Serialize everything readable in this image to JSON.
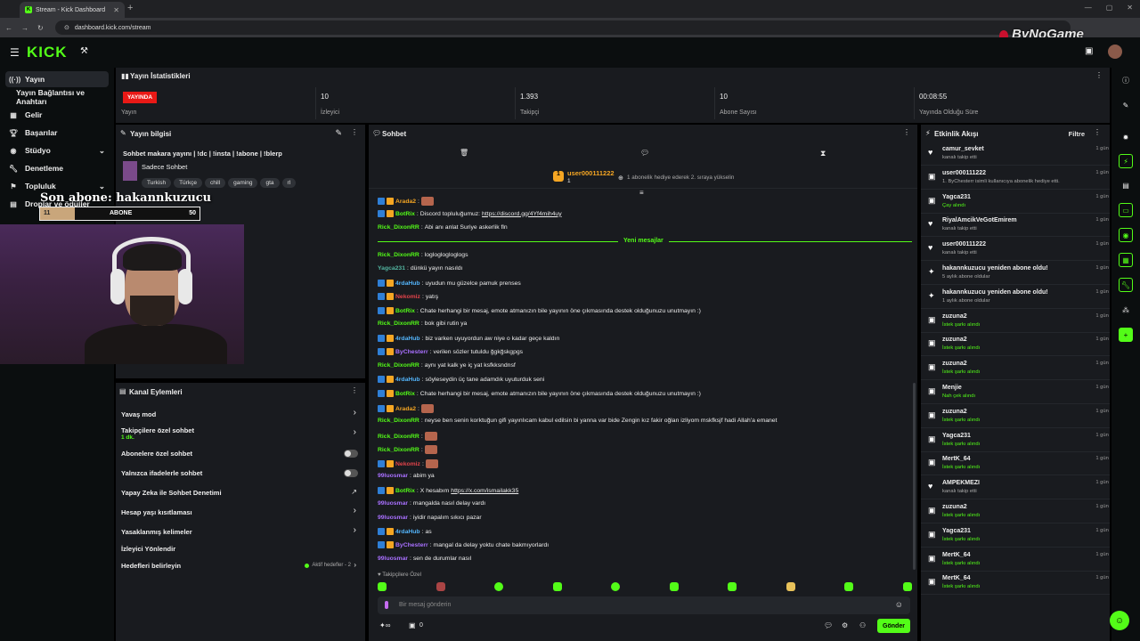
{
  "browser": {
    "tab_title": "Stream - Kick Dashboard",
    "url": "dashboard.kick.com/stream"
  },
  "watermark": "ByNoGame",
  "brand": {
    "logo": "KICK",
    "accent": "#53fc18"
  },
  "sidebar": {
    "items": [
      {
        "label": "Yayın",
        "icon": "broadcast-icon"
      },
      {
        "label": "Yayın Bağlantısı ve Anahtarı",
        "icon": "key-icon"
      },
      {
        "label": "Gelir",
        "icon": "money-icon"
      },
      {
        "label": "Başarılar",
        "icon": "trophy-icon"
      },
      {
        "label": "Stüdyo",
        "icon": "studio-icon"
      },
      {
        "label": "Denetleme",
        "icon": "wrench-icon"
      },
      {
        "label": "Topluluk",
        "icon": "users-icon"
      },
      {
        "label": "Droplar ve ödüller",
        "icon": "gift-icon"
      }
    ]
  },
  "stats": {
    "title": "Yayın İstatistikleri",
    "live_badge": "YAYINDA",
    "items": [
      {
        "value": "",
        "label": "Yayın"
      },
      {
        "value": "10",
        "label": "İzleyici"
      },
      {
        "value": "1.393",
        "label": "Takipçi"
      },
      {
        "value": "10",
        "label": "Abone Sayısı"
      },
      {
        "value": "00:08:55",
        "label": "Yayında Olduğu Süre"
      }
    ]
  },
  "overlay": {
    "subtitle": "Son abone: hakannkuzucu",
    "bar_left": "11",
    "bar_label": "ABONE",
    "bar_right": "50",
    "progress": 0.22
  },
  "stream_info": {
    "title": "Yayın bilgisi",
    "stream_title": "Sohbet makara yayını | !dc | !insta | !abone | !blerp",
    "category": "Sadece Sohbet",
    "tags": [
      "Turkish",
      "Türkçe",
      "chill",
      "gaming",
      "gta",
      "rl"
    ]
  },
  "channel_actions": {
    "title": "Kanal Eylemleri",
    "items": [
      {
        "label": "Yavaş mod",
        "type": "chevron",
        "sub": ""
      },
      {
        "label": "Takipçilere özel sohbet",
        "type": "chevron",
        "sub": "1 dk."
      },
      {
        "label": "Abonelere özel sohbet",
        "type": "toggle",
        "sub": ""
      },
      {
        "label": "Yalnızca ifadelerle sohbet",
        "type": "toggle",
        "sub": ""
      },
      {
        "label": "Yapay Zeka ile Sohbet Denetimi",
        "type": "external",
        "sub": ""
      },
      {
        "label": "Hesap yaşı kısıtlaması",
        "type": "chevron",
        "sub": ""
      },
      {
        "label": "Yasaklanmış kelimeler",
        "type": "chevron",
        "sub": ""
      },
      {
        "label": "İzleyici Yönlendir",
        "type": "none",
        "sub": ""
      },
      {
        "label": "Hedefleri belirleyin",
        "type": "goals",
        "sub": "Aktif hedefler - 2"
      }
    ]
  },
  "chat": {
    "title": "Sohbet",
    "pinned_user": "user000111222",
    "pinned_count": "1",
    "pinned_note": "1 abonelik hediye ederek 2. sıraya yükselin",
    "new_messages_label": "Yeni mesajlar",
    "followers_only_note": "Takipçilere Özel",
    "input_placeholder": "Bir mesaj gönderin",
    "points": "0",
    "send_label": "Gönder",
    "messages": [
      {
        "user": "Arada2",
        "color": "#f5a623",
        "text": ""
      },
      {
        "user": "BotRix",
        "color": "#53fc18",
        "text": "Discord topluluğumuz: ",
        "link": "https://discord.gg/4Yf4mih4uy"
      },
      {
        "user": "Rick_DixonRR",
        "color": "#53fc18",
        "text": "Abi anı anlat Suriye askerlik fln"
      },
      {
        "user": "Rick_DixonRR",
        "color": "#53fc18",
        "text": "logloglogloglogs"
      },
      {
        "user": "Yagca231",
        "color": "#53b5a0",
        "text": "dünkü yayın nasıldı"
      },
      {
        "user": "4rdaHub",
        "color": "#53b5fc",
        "text": "uyudun mu güzelce pamuk prenses"
      },
      {
        "user": "Nekomiz",
        "color": "#e0434a",
        "text": "yatış"
      },
      {
        "user": "BotRix",
        "color": "#53fc18",
        "text": "Chate herhangi bir mesaj, emote atmanızın bile yayının öne çıkmasında destek olduğunuzu unutmayın :)"
      },
      {
        "user": "Rick_DixonRR",
        "color": "#53fc18",
        "text": "bok gibi rutin ya"
      },
      {
        "user": "4rdaHub",
        "color": "#53b5fc",
        "text": "biz varken uyuyordun aw niye o kadar geçe kaldın"
      },
      {
        "user": "ByChesterr",
        "color": "#a970ff",
        "text": "verilen sözler tutuldu ğgkğskgpgs"
      },
      {
        "user": "Rick_DixonRR",
        "color": "#53fc18",
        "text": "aynı yat kalk ye iç yat ksfkksndnsf"
      },
      {
        "user": "4rdaHub",
        "color": "#53b5fc",
        "text": "söyleseydin üç tane adamdık uyuturduk seni"
      },
      {
        "user": "BotRix",
        "color": "#53fc18",
        "text": "Chate herhangi bir mesaj, emote atmanızın bile yayının öne çıkmasında destek olduğunuzu unutmayın :)"
      },
      {
        "user": "Arada2",
        "color": "#f5a623",
        "text": ""
      },
      {
        "user": "Rick_DixonRR",
        "color": "#53fc18",
        "text": "neyse ben senin korktuğun gifi yayınlıcam kabul edilsin bi yanna var bide Zengin kız fakir oğlan izliyom mskfksjf hadi Allah'a emanet"
      },
      {
        "user": "Rick_DixonRR",
        "color": "#53fc18",
        "text": ""
      },
      {
        "user": "Rick_DixonRR",
        "color": "#53fc18",
        "text": ""
      },
      {
        "user": "Nekomiz",
        "color": "#e0434a",
        "text": ""
      },
      {
        "user": "99luosmar",
        "color": "#a970ff",
        "text": "abim ya"
      },
      {
        "user": "BotRix",
        "color": "#53fc18",
        "text": "X hesabım ",
        "link": "https://x.com/ismailakk35"
      },
      {
        "user": "99luosmar",
        "color": "#a970ff",
        "text": "mangalda nasıl delay vardı"
      },
      {
        "user": "99luosmar",
        "color": "#a970ff",
        "text": "iyidir napalım sıkıcı pazar"
      },
      {
        "user": "4rdaHub",
        "color": "#53b5fc",
        "text": "as"
      },
      {
        "user": "ByChesterr",
        "color": "#a970ff",
        "text": "mangal da delay yoktu chate bakmıyorlardı"
      },
      {
        "user": "99luosmar",
        "color": "#a970ff",
        "text": "sen de durumlar nasıl"
      }
    ]
  },
  "events": {
    "title": "Etkinlik Akışı",
    "filter_label": "Filtre",
    "items": [
      {
        "name": "camur_sevket",
        "sub": "kanalı takip etti",
        "icon": "heart-icon",
        "time": "1 gün önce",
        "sub_color": "#aaa"
      },
      {
        "name": "user000111222",
        "sub": "1. ByChesterr isimli kullanıcıya abonelik hediye etti.",
        "icon": "gift-icon",
        "time": "1 gün önce",
        "sub_color": "#aaa"
      },
      {
        "name": "Yagca231",
        "sub": "Çay alındı",
        "icon": "gift-icon",
        "time": "1 gün önce",
        "sub_color": "#53fc18"
      },
      {
        "name": "RiyalAmcikVeGotEmirem",
        "sub": "kanalı takip etti",
        "icon": "heart-icon",
        "time": "1 gün önce",
        "sub_color": "#aaa"
      },
      {
        "name": "user000111222",
        "sub": "kanalı takip etti",
        "icon": "heart-icon",
        "time": "1 gün önce",
        "sub_color": "#aaa"
      },
      {
        "name": "hakannkuzucu yeniden abone oldu!",
        "sub": "5 aylık abone oldular",
        "icon": "star-icon",
        "time": "1 gün önce",
        "sub_color": "#aaa"
      },
      {
        "name": "hakannkuzucu yeniden abone oldu!",
        "sub": "1 aylık abone oldular",
        "icon": "star-icon",
        "time": "1 gün önce",
        "sub_color": "#aaa"
      },
      {
        "name": "zuzuna2",
        "sub": "İstek şarkı alındı",
        "icon": "gift-icon",
        "time": "1 gün önce",
        "sub_color": "#53fc18"
      },
      {
        "name": "zuzuna2",
        "sub": "İstek şarkı alındı",
        "icon": "gift-icon",
        "time": "1 gün önce",
        "sub_color": "#53fc18"
      },
      {
        "name": "zuzuna2",
        "sub": "İstek şarkı alındı",
        "icon": "gift-icon",
        "time": "1 gün önce",
        "sub_color": "#53fc18"
      },
      {
        "name": "Menjie",
        "sub": "Nah çek alındı",
        "icon": "gift-icon",
        "time": "1 gün önce",
        "sub_color": "#53fc18"
      },
      {
        "name": "zuzuna2",
        "sub": "İstek şarkı alındı",
        "icon": "gift-icon",
        "time": "1 gün önce",
        "sub_color": "#53fc18"
      },
      {
        "name": "Yagca231",
        "sub": "İstek şarkı alındı",
        "icon": "gift-icon",
        "time": "1 gün önce",
        "sub_color": "#53fc18"
      },
      {
        "name": "MertK_64",
        "sub": "İstek şarkı alındı",
        "icon": "gift-icon",
        "time": "1 gün önce",
        "sub_color": "#53fc18"
      },
      {
        "name": "AMPEKMEZI",
        "sub": "kanalı takip etti",
        "icon": "heart-icon",
        "time": "1 gün önce",
        "sub_color": "#aaa"
      },
      {
        "name": "zuzuna2",
        "sub": "İstek şarkı alındı",
        "icon": "gift-icon",
        "time": "1 gün önce",
        "sub_color": "#53fc18"
      },
      {
        "name": "Yagca231",
        "sub": "İstek şarkı alındı",
        "icon": "gift-icon",
        "time": "1 gün önce",
        "sub_color": "#53fc18"
      },
      {
        "name": "MertK_64",
        "sub": "İstek şarkı alındı",
        "icon": "gift-icon",
        "time": "1 gün önce",
        "sub_color": "#53fc18"
      },
      {
        "name": "MertK_64",
        "sub": "İstek şarkı alındı",
        "icon": "gift-icon",
        "time": "1 gün önce",
        "sub_color": "#53fc18"
      }
    ]
  }
}
